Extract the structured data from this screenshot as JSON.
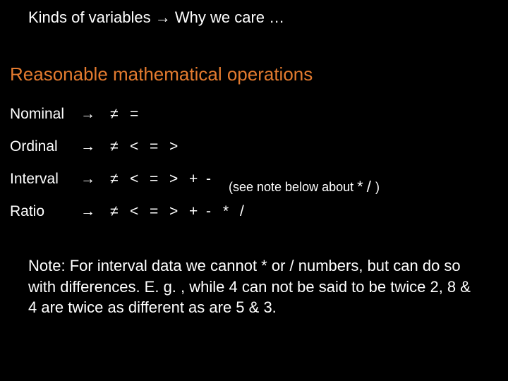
{
  "title_pre": "Kinds of variables ",
  "title_arrow": "→",
  "title_post": " Why we care …",
  "subtitle": "Reasonable mathematical operations",
  "rows": {
    "r0": {
      "label": "Nominal",
      "arrow": "→",
      "c0": "≠",
      "c1": "="
    },
    "r1": {
      "label": "Ordinal",
      "arrow": "→",
      "c0": "≠",
      "c1": "<",
      "c2": "=",
      "c3": ">"
    },
    "r2": {
      "label": "Interval",
      "arrow": "→",
      "c0": "≠",
      "c1": "<",
      "c2": "=",
      "c3": ">",
      "c4": "+",
      "c5": "-",
      "note_pre": "(see note below about ",
      "note_s1": "*",
      "note_mid": " / ",
      "note_post": ")"
    },
    "r3": {
      "label": "Ratio",
      "arrow": "→",
      "c0": "≠",
      "c1": "<",
      "c2": "=",
      "c3": ">",
      "c4": "+",
      "c5": "-",
      "c6": "*",
      "c7": "/"
    }
  },
  "footnote": "Note: For interval data we cannot * or / numbers, but can do so with differences.  E. g. ,  while 4 can not be said to be twice 2, 8 & 4  are twice as different as are 5 & 3."
}
